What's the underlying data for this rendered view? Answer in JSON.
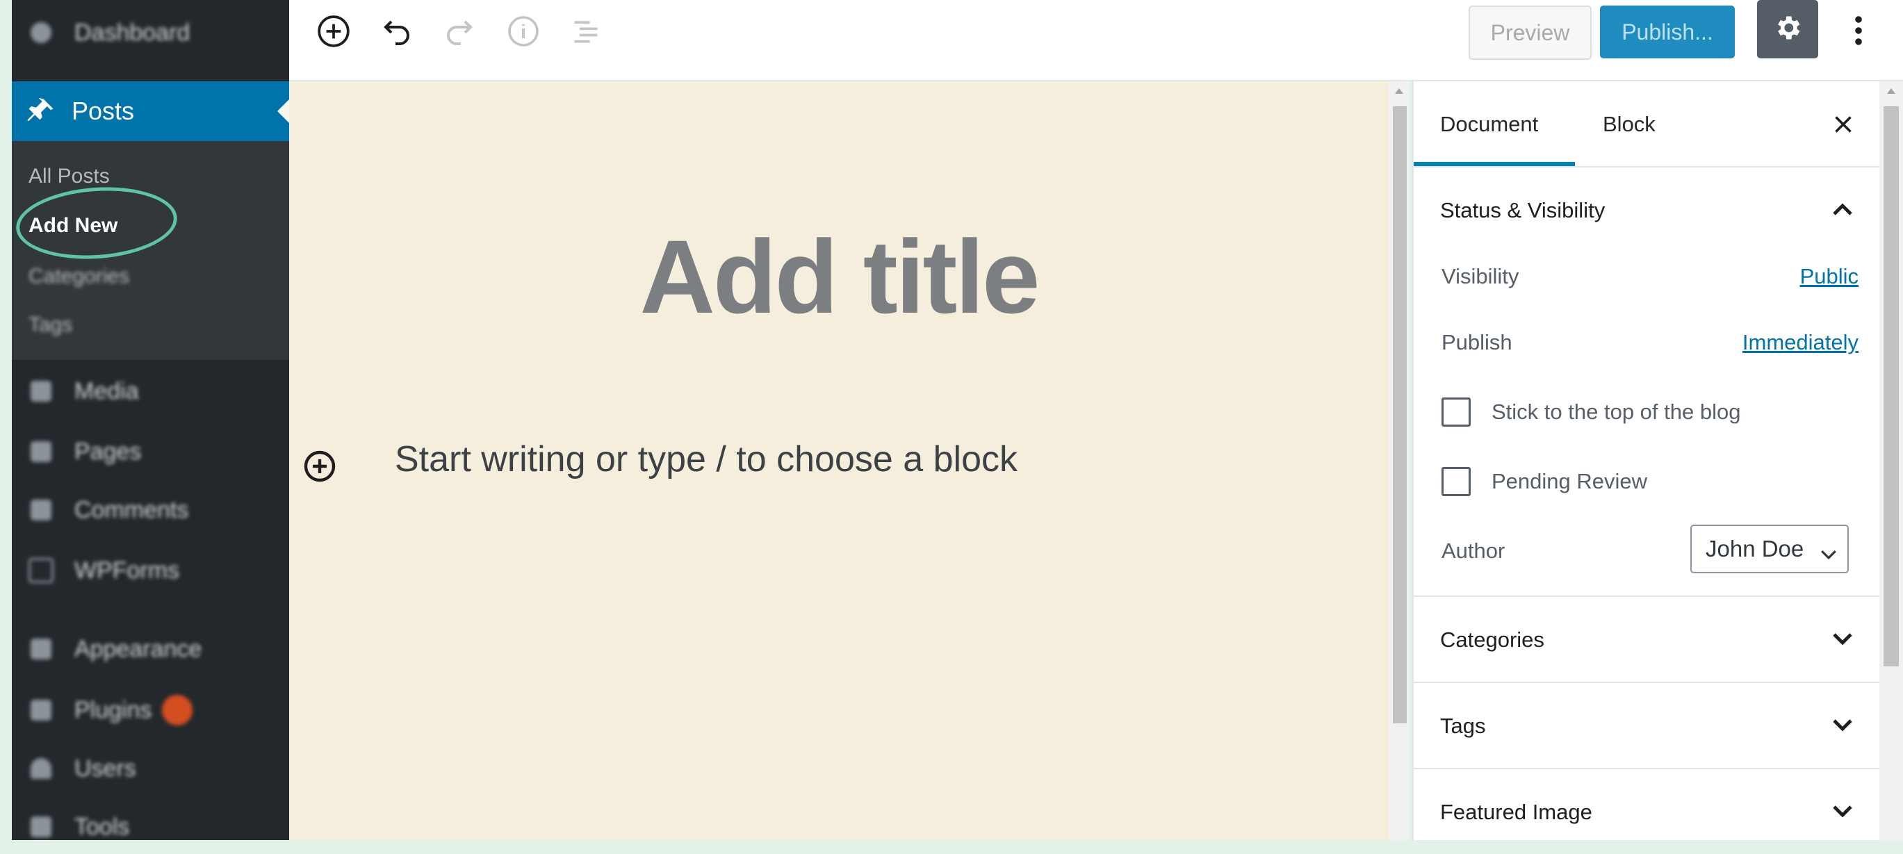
{
  "admin_menu": {
    "dashboard_label": "Dashboard",
    "posts_label": "Posts",
    "submenu": {
      "all_posts": "All Posts",
      "add_new": "Add New",
      "categories": "Categories",
      "tags": "Tags"
    },
    "items": [
      "Media",
      "Pages",
      "Comments",
      "WPForms",
      "Appearance",
      "Plugins",
      "Users",
      "Tools"
    ],
    "highlight_color": "#5fc3a6",
    "active_color": "#0073aa"
  },
  "toolbar": {
    "preview_label": "Preview",
    "publish_label": "Publish...",
    "icons": [
      "add-block-icon",
      "undo-icon",
      "redo-icon",
      "info-icon",
      "outline-icon",
      "gear-icon",
      "more-vertical-icon"
    ]
  },
  "editor": {
    "title_placeholder": "Add title",
    "block_placeholder": "Start writing or type / to choose a block"
  },
  "sidebar": {
    "tabs": [
      "Document",
      "Block"
    ],
    "active_tab": "Document",
    "status_panel": {
      "title": "Status & Visibility",
      "visibility_label": "Visibility",
      "visibility_value": "Public",
      "publish_label": "Publish",
      "publish_value": "Immediately",
      "sticky_label": "Stick to the top of the blog",
      "pending_label": "Pending Review",
      "author_label": "Author",
      "author_value": "John Doe"
    },
    "panels": [
      "Categories",
      "Tags",
      "Featured Image"
    ]
  }
}
